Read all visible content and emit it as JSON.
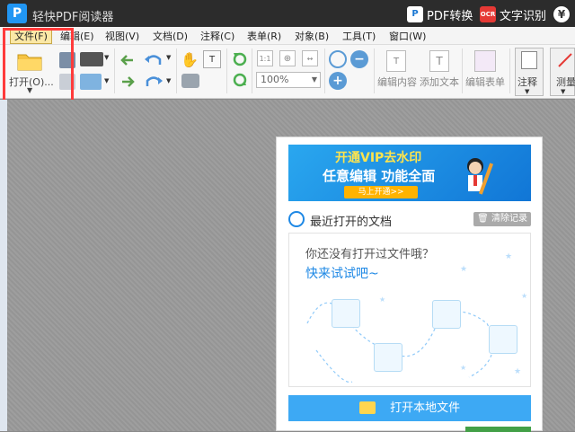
{
  "title_bar": {
    "app_title": "轻快PDF阅读器",
    "pdf_convert_label": "PDF转换",
    "ocr_label": "文字识别",
    "ocr_icon_text": "OCR",
    "logo_letter": "P",
    "yen_symbol": "¥"
  },
  "menu": {
    "items": [
      "文件(F)",
      "编辑(E)",
      "视图(V)",
      "文档(D)",
      "注释(C)",
      "表单(R)",
      "对象(B)",
      "工具(T)",
      "窗口(W)"
    ],
    "active_index": 0
  },
  "toolbar": {
    "open_label": "打开(O)...",
    "zoom_value": "100%",
    "edit_content_label": "编辑内容",
    "add_text_label": "添加文本",
    "edit_form_label": "编辑表单",
    "annotate_label": "注释",
    "measure_label": "测量"
  },
  "start_panel": {
    "banner_line1": "开通VIP去水印",
    "banner_line2": "任意编辑 功能全面",
    "banner_button": "马上开通>>",
    "recent_title": "最近打开的文档",
    "clear_history_label": "清除记录",
    "empty_question": "你还没有打开过文件哦？",
    "empty_try": "快来试试吧~",
    "open_local_label": "打开本地文件"
  },
  "colors": {
    "accent": "#3da9f4",
    "highlight_box": "#ff3b3b",
    "titlebar": "#2c2c2c"
  }
}
